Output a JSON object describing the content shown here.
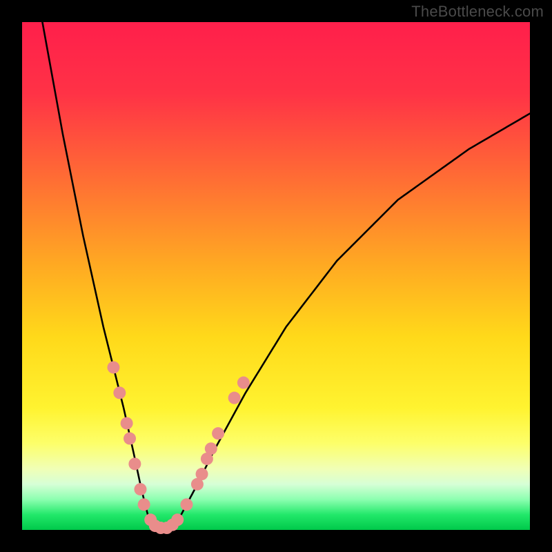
{
  "watermark": "TheBottleneck.com",
  "gradient": {
    "stops": [
      {
        "pct": 0,
        "color": "#ff1f4b"
      },
      {
        "pct": 14,
        "color": "#ff3246"
      },
      {
        "pct": 30,
        "color": "#ff6a35"
      },
      {
        "pct": 48,
        "color": "#ffaa22"
      },
      {
        "pct": 62,
        "color": "#ffd91a"
      },
      {
        "pct": 76,
        "color": "#fff330"
      },
      {
        "pct": 83,
        "color": "#fdff6a"
      },
      {
        "pct": 88,
        "color": "#f0ffb6"
      },
      {
        "pct": 91,
        "color": "#d6ffd6"
      },
      {
        "pct": 94,
        "color": "#8cffb0"
      },
      {
        "pct": 97,
        "color": "#22e86a"
      },
      {
        "pct": 100,
        "color": "#00c94a"
      }
    ]
  },
  "curve_style": {
    "stroke": "#000000",
    "stroke_width": 2.6,
    "dot_fill": "#e98d8b",
    "dot_radius": 9
  },
  "chart_data": {
    "type": "line",
    "title": "",
    "xlabel": "",
    "ylabel": "",
    "xlim": [
      0,
      100
    ],
    "ylim": [
      0,
      100
    ],
    "annotations": [
      "TheBottleneck.com"
    ],
    "series": [
      {
        "name": "left-branch",
        "x": [
          4,
          6,
          8,
          10,
          12,
          14,
          16,
          18,
          20,
          22,
          23.5,
          25
        ],
        "y": [
          100,
          89,
          78,
          68,
          58,
          49,
          40,
          32,
          24,
          15,
          8,
          2
        ]
      },
      {
        "name": "valley-floor",
        "x": [
          25,
          26,
          27,
          28,
          29,
          30,
          31
        ],
        "y": [
          2,
          0.7,
          0.3,
          0.3,
          0.5,
          1.2,
          2.4
        ]
      },
      {
        "name": "right-branch",
        "x": [
          31,
          34,
          38,
          44,
          52,
          62,
          74,
          88,
          100
        ],
        "y": [
          2.4,
          8,
          16,
          27,
          40,
          53,
          65,
          75,
          82
        ]
      }
    ],
    "markers": [
      {
        "series": "left-dots",
        "points": [
          {
            "x": 18.0,
            "y": 32
          },
          {
            "x": 19.2,
            "y": 27
          },
          {
            "x": 20.6,
            "y": 21
          },
          {
            "x": 21.2,
            "y": 18
          },
          {
            "x": 22.2,
            "y": 13
          },
          {
            "x": 23.3,
            "y": 8
          },
          {
            "x": 24.0,
            "y": 5
          },
          {
            "x": 25.3,
            "y": 2
          }
        ]
      },
      {
        "series": "floor-dots",
        "points": [
          {
            "x": 26.2,
            "y": 0.8
          },
          {
            "x": 27.3,
            "y": 0.4
          },
          {
            "x": 28.5,
            "y": 0.4
          },
          {
            "x": 29.6,
            "y": 1.0
          },
          {
            "x": 30.6,
            "y": 2.0
          }
        ]
      },
      {
        "series": "right-dots",
        "points": [
          {
            "x": 32.4,
            "y": 5
          },
          {
            "x": 34.5,
            "y": 9
          },
          {
            "x": 35.4,
            "y": 11
          },
          {
            "x": 36.4,
            "y": 14
          },
          {
            "x": 37.2,
            "y": 16
          },
          {
            "x": 38.6,
            "y": 19
          },
          {
            "x": 41.8,
            "y": 26
          },
          {
            "x": 43.6,
            "y": 29
          }
        ]
      }
    ]
  }
}
